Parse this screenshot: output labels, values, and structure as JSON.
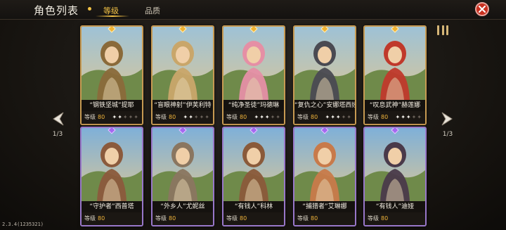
{
  "header": {
    "title": "角色列表",
    "tabs": [
      {
        "label": "等级",
        "active": true
      },
      {
        "label": "品质",
        "active": false
      }
    ]
  },
  "pager": {
    "left_page": "1/3",
    "right_page": "1/3"
  },
  "level_label": "等级",
  "characters": [
    {
      "name": "“钢铁坚城”提耶",
      "level": "80",
      "stars_on": 2,
      "rarity": "gold",
      "theme": "#8a6a3a"
    },
    {
      "name": "“盲眼神射”伊芙利特",
      "level": "80",
      "stars_on": 2,
      "rarity": "gold",
      "theme": "#c9a66a"
    },
    {
      "name": "“纯净圣徒”玛德琳",
      "level": "80",
      "stars_on": 3,
      "rarity": "gold",
      "theme": "#e58fa5"
    },
    {
      "name": "“复仇之心”安娜塔西娅",
      "level": "80",
      "stars_on": 3,
      "rarity": "gold",
      "theme": "#4a4a52"
    },
    {
      "name": "“叹息武神”赫莲娜",
      "level": "80",
      "stars_on": 3,
      "rarity": "gold",
      "theme": "#c0392b"
    },
    {
      "name": "“守护者”西普塔",
      "level": "80",
      "stars_on": 0,
      "rarity": "purple",
      "theme": "#8b5a3c"
    },
    {
      "name": "“外乡人”尤妮丝",
      "level": "80",
      "stars_on": 0,
      "rarity": "purple",
      "theme": "#8a7660"
    },
    {
      "name": "“有钱人”科林",
      "level": "80",
      "stars_on": 0,
      "rarity": "purple",
      "theme": "#8a5a3a"
    },
    {
      "name": "“捕猎者”艾琳娜",
      "level": "80",
      "stars_on": 0,
      "rarity": "purple",
      "theme": "#c87a4a"
    },
    {
      "name": "“有钱人”迪娅",
      "level": "80",
      "stars_on": 0,
      "rarity": "purple",
      "theme": "#4a3a4a"
    }
  ],
  "version": "2.3.4(1235321)",
  "colors": {
    "accent_gold": "#f3c246",
    "level_value": "#f0b43a",
    "close_red": "#c8301f"
  },
  "icons": {
    "close": "close-icon",
    "grid": "grid-view-icon",
    "prev": "prev-arrow-icon",
    "next": "next-arrow-icon"
  }
}
